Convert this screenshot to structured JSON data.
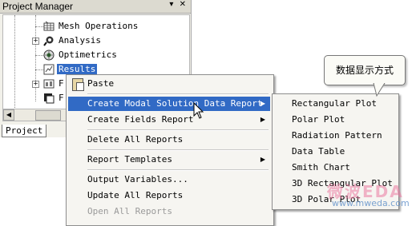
{
  "panel": {
    "title": "Project Manager",
    "buttons": "▾ ✕",
    "tab": "Project"
  },
  "tree": {
    "items": [
      {
        "label": "Mesh Operations",
        "icon": "mesh-icon"
      },
      {
        "label": "Analysis",
        "icon": "analysis-icon"
      },
      {
        "label": "Optimetrics",
        "icon": "optimetrics-icon"
      },
      {
        "label": "Results",
        "icon": "results-icon",
        "selected": true
      },
      {
        "label": "F",
        "icon": "field-overlays-icon"
      },
      {
        "label": "F",
        "icon": "definitions-icon"
      }
    ]
  },
  "context_menu": {
    "paste": "Paste",
    "create_modal": "Create Modal Solution Data Report",
    "create_fields": "Create Fields Report",
    "delete_all": "Delete All Reports",
    "report_templates": "Report Templates",
    "output_variables": "Output Variables...",
    "update_all": "Update All Reports",
    "open_all": "Open All Reports"
  },
  "submenu": {
    "items": [
      "Rectangular Plot",
      "Polar Plot",
      "Radiation Pattern",
      "Data Table",
      "Smith Chart",
      "3D Rectangular Plot",
      "3D Polar Plot"
    ]
  },
  "callout": {
    "text": "数据显示方式"
  },
  "watermark": {
    "logo": "微波EDA",
    "url": "www.mweda.com"
  },
  "colors": {
    "highlight": "#316ac5",
    "menu_bg": "#f6f5f1",
    "panel_bg": "#f2f1ea"
  }
}
